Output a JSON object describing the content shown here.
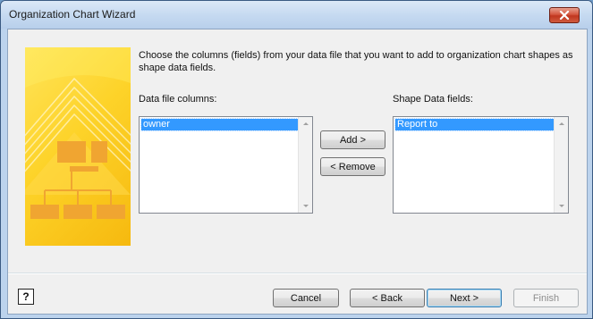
{
  "window": {
    "title": "Organization Chart Wizard"
  },
  "instructions": "Choose the columns (fields) from your data file that you want to add to organization chart shapes as shape data fields.",
  "left_list": {
    "label": "Data file columns:",
    "items": [
      "owner"
    ],
    "selected": "owner"
  },
  "right_list": {
    "label": "Shape Data fields:",
    "items": [
      "Report to"
    ],
    "selected": "Report to"
  },
  "buttons": {
    "add": "Add >",
    "remove": "< Remove",
    "cancel": "Cancel",
    "back": "< Back",
    "next": "Next >",
    "finish": "Finish"
  },
  "help_glyph": "?",
  "colors": {
    "selection": "#3399ff",
    "banner_yellow": "#fdd329",
    "close_red": "#c0361f"
  }
}
